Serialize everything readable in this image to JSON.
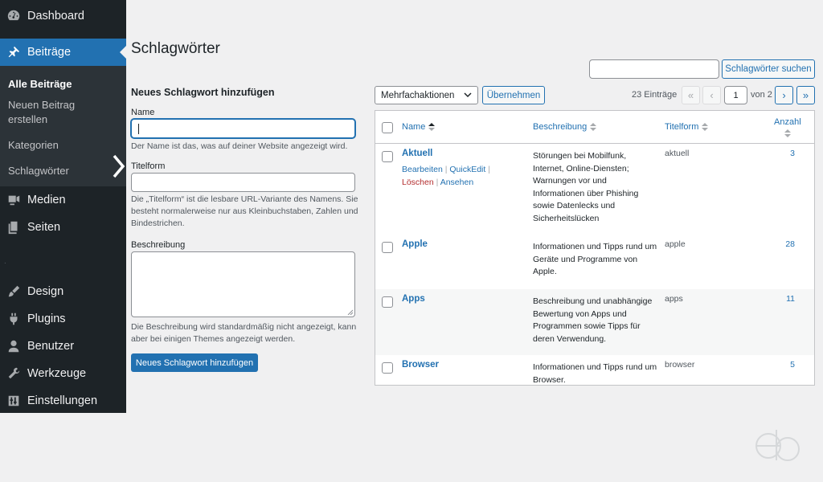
{
  "sidebar": {
    "items": [
      {
        "label": "Dashboard",
        "icon": "dashboard-icon"
      },
      {
        "label": "Beiträge",
        "icon": "pin-icon",
        "active": true
      },
      {
        "label": "Medien",
        "icon": "media-icon"
      },
      {
        "label": "Seiten",
        "icon": "pages-icon"
      },
      {
        "label": "Design",
        "icon": "brush-icon"
      },
      {
        "label": "Plugins",
        "icon": "plugin-icon"
      },
      {
        "label": "Benutzer",
        "icon": "user-icon"
      },
      {
        "label": "Werkzeuge",
        "icon": "wrench-icon"
      },
      {
        "label": "Einstellungen",
        "icon": "settings-icon"
      }
    ],
    "submenu": [
      "Alle Beiträge",
      "Neuen Beitrag erstellen",
      "Kategorien",
      "Schlagwörter"
    ],
    "separator": "."
  },
  "page": {
    "title": "Schlagwörter"
  },
  "search": {
    "placeholder": "",
    "button": "Schlagwörter suchen"
  },
  "form": {
    "heading": "Neues Schlagwort hinzufügen",
    "name_label": "Name",
    "name_help": "Der Name ist das, was auf deiner Website angezeigt wird.",
    "slug_label": "Titelform",
    "slug_help": "Die „Titelform“ ist die lesbare URL-Variante des Namens. Sie besteht normalerweise nur aus Kleinbuchstaben, Zahlen und Bindestrichen.",
    "desc_label": "Beschreibung",
    "desc_help": "Die Beschreibung wird standardmäßig nicht angezeigt, kann aber bei einigen Themes angezeigt werden.",
    "submit": "Neues Schlagwort hinzufügen"
  },
  "table_controls": {
    "bulk_action": "Mehrfachaktionen",
    "apply": "Übernehmen",
    "count": "23 Einträge",
    "first": "«",
    "prev": "‹",
    "current_page": "1",
    "of": "von 2",
    "next": "›",
    "last": "»"
  },
  "table": {
    "columns": [
      "Name",
      "Beschreibung",
      "Titelform",
      "Anzahl"
    ],
    "row_actions": {
      "edit": "Bearbeiten",
      "quickedit": "QuickEdit",
      "delete": "Löschen",
      "view": "Ansehen",
      "sep": "|"
    },
    "rows": [
      {
        "name": "Aktuell",
        "desc": "Störungen bei Mobilfunk, Internet, Online-Diensten; Warnungen vor und Informationen über Phishing sowie Datenlecks und Sicherheitslücken",
        "slug": "aktuell",
        "count": "3"
      },
      {
        "name": "Apple",
        "desc": "Informationen und Tipps rund um Geräte und Programme von Apple.",
        "slug": "apple",
        "count": "28"
      },
      {
        "name": "Apps",
        "desc": "Beschreibung und unabhängige Bewertung von Apps und Programmen sowie Tipps für deren Verwendung.",
        "slug": "apps",
        "count": "11"
      },
      {
        "name": "Browser",
        "desc": "Informationen und Tipps rund um Browser.",
        "slug": "browser",
        "count": "5"
      }
    ]
  },
  "colors": {
    "sidebar": "#1d2327",
    "accent": "#2271b1",
    "danger": "#b32d2e",
    "background": "#f0f0f1"
  }
}
